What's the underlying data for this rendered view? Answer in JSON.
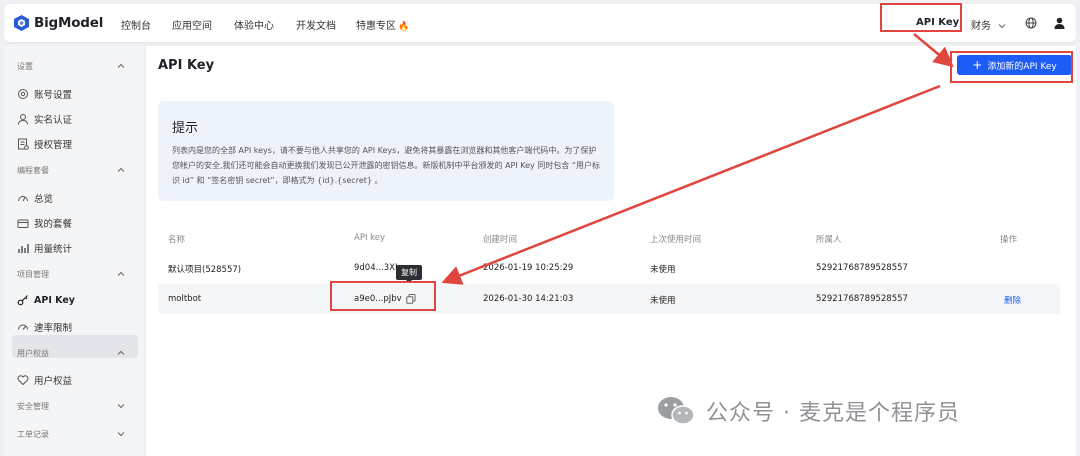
{
  "app": {
    "name": "BigModel"
  },
  "nav": {
    "items": [
      {
        "label": "控制台"
      },
      {
        "label": "应用空间"
      },
      {
        "label": "体验中心"
      },
      {
        "label": "开发文档"
      },
      {
        "label": "特惠专区"
      }
    ],
    "right": {
      "api_key": "API Key",
      "finance": "财务"
    }
  },
  "sidebar": {
    "groups": [
      {
        "label": "设置",
        "items": [
          {
            "label": "账号设置",
            "icon": "gear-icon"
          },
          {
            "label": "实名认证",
            "icon": "user-icon"
          },
          {
            "label": "授权管理",
            "icon": "document-icon"
          }
        ]
      },
      {
        "label": "编程套餐",
        "items": [
          {
            "label": "总览",
            "icon": "dashboard-icon"
          },
          {
            "label": "我的套餐",
            "icon": "package-icon"
          },
          {
            "label": "用量统计",
            "icon": "chart-icon"
          }
        ]
      },
      {
        "label": "项目管理",
        "items": [
          {
            "label": "API Key",
            "icon": "key-icon",
            "active": true
          },
          {
            "label": "速率限制",
            "icon": "speed-icon"
          }
        ]
      },
      {
        "label": "用户权益",
        "items": [
          {
            "label": "用户权益",
            "icon": "heart-icon"
          }
        ]
      },
      {
        "label": "安全管理",
        "items": []
      },
      {
        "label": "工单记录",
        "items": []
      }
    ]
  },
  "main": {
    "title": "API Key",
    "add_button": "添加新的API Key",
    "notice": {
      "title": "提示",
      "body": "列表内是您的全部 API keys，请不要与他人共享您的 API Keys，避免将其暴露在浏览器和其他客户端代码中。为了保护您帐户的安全,我们还可能会自动更换我们发现已公开泄露的密钥信息。新版机制中平台颁发的 API Key 同时包含 “用户标识 id” 和 “签名密钥 secret”，即格式为 {id}.{secret} 。"
    },
    "table": {
      "headers": [
        "名称",
        "API key",
        "创建时间",
        "上次使用时间",
        "所属人",
        "操作"
      ],
      "rows": [
        {
          "name": "默认项目(528557)",
          "key": "9d04...3XL",
          "created": "2026-01-19 10:25:29",
          "last_used": "未使用",
          "owner": "52921768789528557",
          "action": ""
        },
        {
          "name": "moltbot",
          "key": "a9e0...pJbv",
          "created": "2026-01-30 14:21:03",
          "last_used": "未使用",
          "owner": "52921768789528557",
          "action": "删除"
        }
      ],
      "tooltip": "复制"
    }
  },
  "watermark": "公众号 · 麦克是个程序员",
  "colors": {
    "accent": "#1d5cf5",
    "annotation": "#e0453f"
  }
}
